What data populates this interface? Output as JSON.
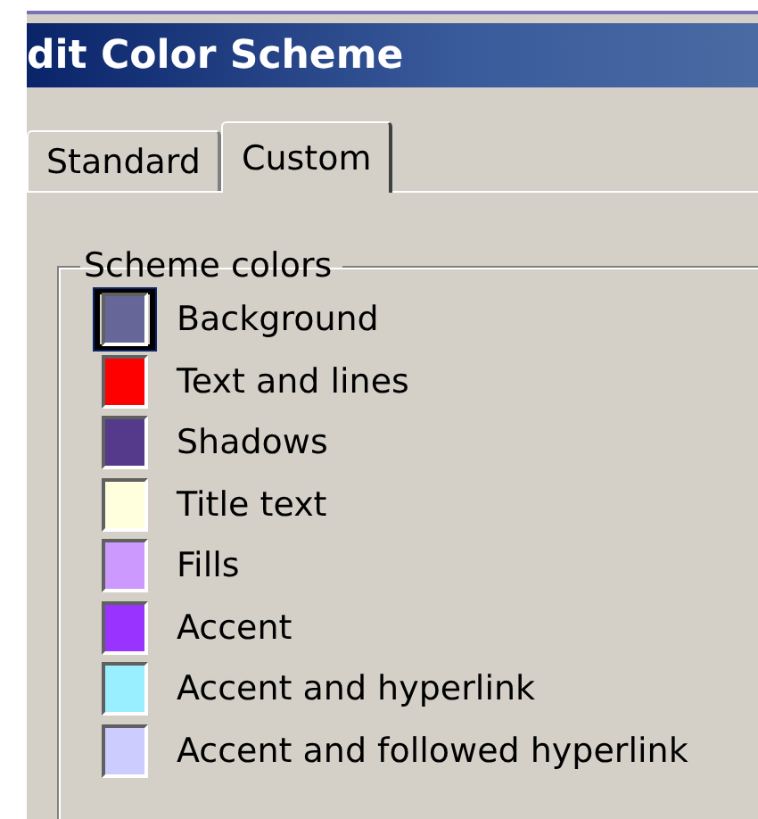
{
  "window": {
    "title": "dit Color Scheme"
  },
  "tabs": [
    {
      "label": "Standard",
      "selected": false
    },
    {
      "label": "Custom",
      "selected": true
    }
  ],
  "group": {
    "title": "Scheme colors",
    "items": [
      {
        "label": "Background",
        "color": "#666699",
        "selected": true
      },
      {
        "label": "Text and lines",
        "color": "#ff0000",
        "selected": false
      },
      {
        "label": "Shadows",
        "color": "#553a8c",
        "selected": false
      },
      {
        "label": "Title text",
        "color": "#ffffdd",
        "selected": false
      },
      {
        "label": "Fills",
        "color": "#cc99ff",
        "selected": false
      },
      {
        "label": "Accent",
        "color": "#9933ff",
        "selected": false
      },
      {
        "label": "Accent and hyperlink",
        "color": "#99eeff",
        "selected": false
      },
      {
        "label": "Accent and followed hyperlink",
        "color": "#ccccff",
        "selected": false
      }
    ]
  }
}
